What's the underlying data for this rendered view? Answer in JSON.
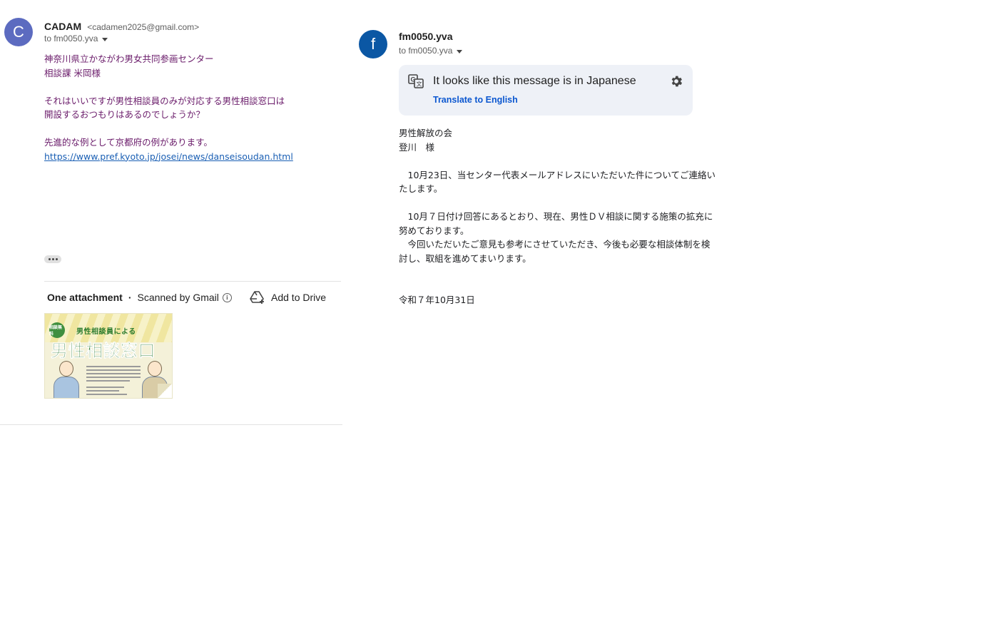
{
  "left_message": {
    "avatar_letter": "C",
    "sender_name": "CADAM",
    "sender_email": "<cadamen2025@gmail.com>",
    "to": "to fm0050.yva",
    "body_lines": [
      "神奈川県立かながわ男女共同参画センター",
      "相談課 米岡様",
      "",
      "それはいいですが男性相談員のみが対応する男性相談窓口は",
      "開設するおつもりはあるのでしょうか？",
      "",
      "先進的な例として京都府の例があります。"
    ],
    "link": "https://www.pref.kyoto.jp/josei/news/danseisoudan.html",
    "attachment": {
      "count_label": "One attachment",
      "scanned_label": "Scanned by Gmail",
      "add_to_drive_label": "Add to Drive",
      "thumbnail": {
        "badge": "相談無料",
        "subtitle": "男性相談員による",
        "title": "男性相談窓口"
      }
    }
  },
  "right_message": {
    "avatar_letter": "f",
    "sender_name": "fm0050.yva",
    "to": "to fm0050.yva",
    "translate_banner": {
      "message": "It looks like this message is in Japanese",
      "action": "Translate to English"
    },
    "body_lines": [
      "男性解放の会",
      "登川　様",
      "",
      "　10月23日、当センター代表メールアドレスにいただいた件についてご連絡い",
      "たします。",
      "",
      "　10月７日付け回答にあるとおり、現在、男性ＤＶ相談に関する施策の拡充に",
      "努めております。",
      "　今回いただいたご意見も参考にさせていただき、今後も必要な相談体制を検",
      "討し、取組を進めてまいります。",
      "",
      "",
      "令和７年10月31日"
    ]
  },
  "colors": {
    "left_avatar": "#5c6bc0",
    "right_avatar": "#0b57a4",
    "left_body_text": "#6a1b6a",
    "link": "#1a5fb4",
    "translate_banner_bg": "#eef1f7",
    "translate_link": "#0b57d0"
  }
}
